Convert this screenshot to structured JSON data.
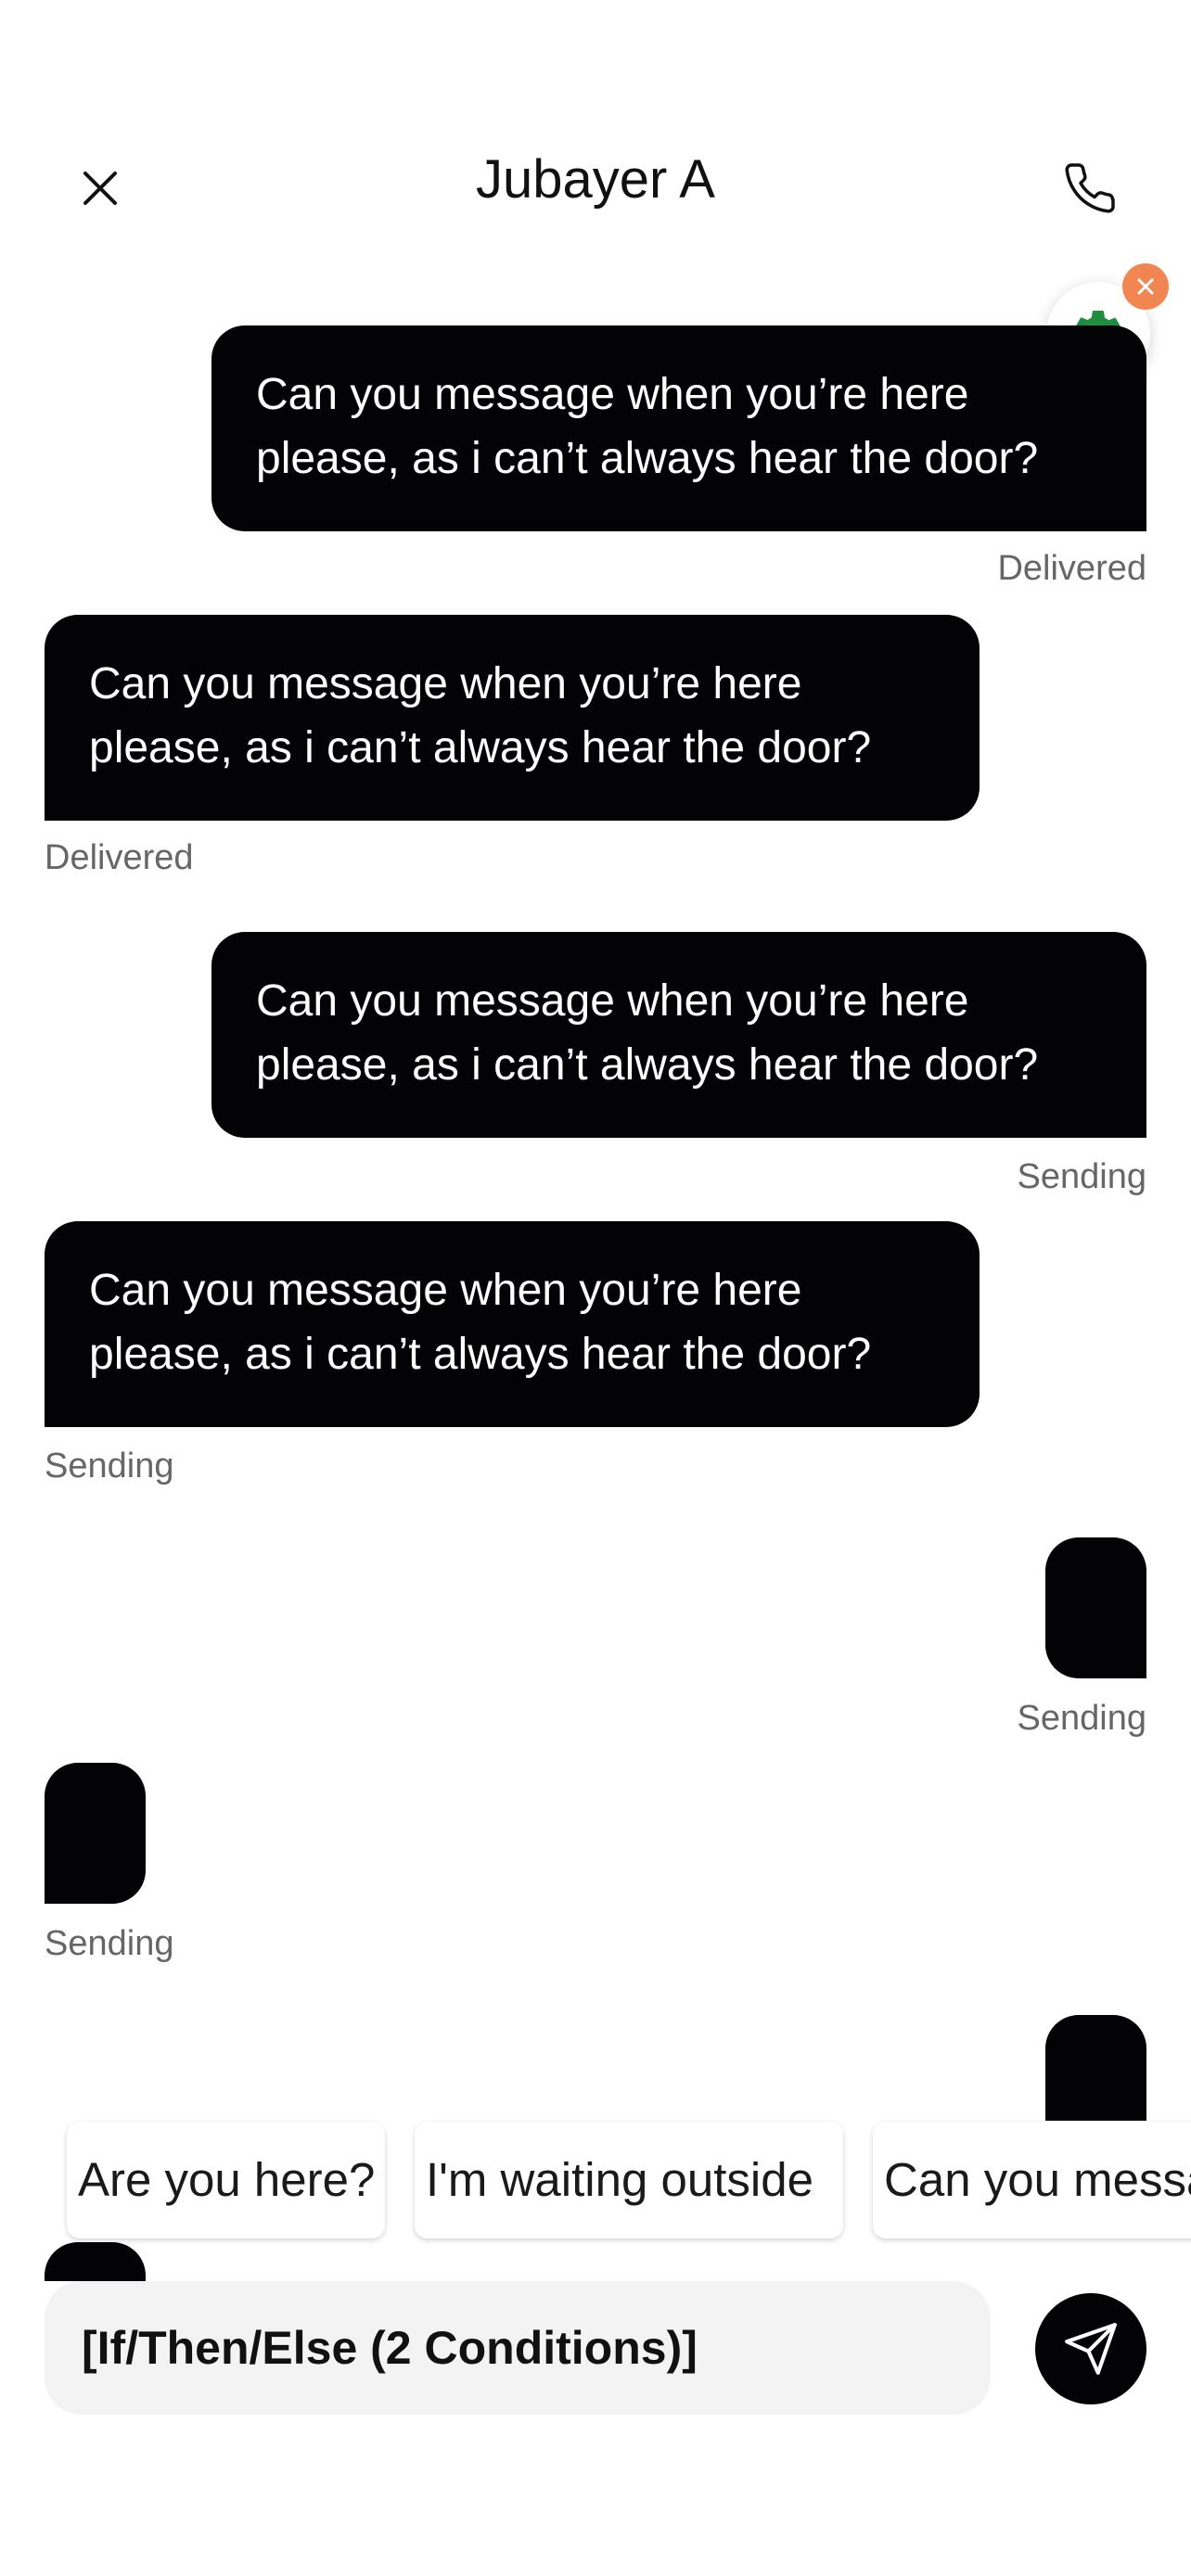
{
  "header": {
    "title": "Jubayer A",
    "close_icon": "close-icon",
    "call_icon": "phone-icon"
  },
  "fab": {
    "icon": "gear-icon",
    "dismiss_icon": "close-icon",
    "accent": "#1f8f3f",
    "dismiss_color": "#f28653"
  },
  "messages": [
    {
      "direction": "outgoing",
      "text": "Can you message when you’re here please, as i can’t always hear the door?",
      "status": "Delivered"
    },
    {
      "direction": "incoming",
      "text": "Can you message when you’re here please, as i can’t always hear the door?",
      "status": "Delivered"
    },
    {
      "direction": "outgoing",
      "text": "Can you message when you’re here please, as i can’t always hear the door?",
      "status": "Sending"
    },
    {
      "direction": "incoming",
      "text": "Can you message when you’re here please, as i can’t always hear the door?",
      "status": "Sending"
    },
    {
      "direction": "outgoing",
      "text": "",
      "status": "Sending"
    },
    {
      "direction": "incoming",
      "text": "",
      "status": "Sending"
    },
    {
      "direction": "outgoing",
      "text": "",
      "status": ""
    },
    {
      "direction": "incoming",
      "text": "",
      "status": ""
    }
  ],
  "quick_replies": [
    "Are you here?",
    "I'm waiting outside",
    "Can you messa"
  ],
  "composer": {
    "value": "[If/Then/Else (2 Conditions)]",
    "send_icon": "send-icon"
  },
  "colors": {
    "bubble": "#030305",
    "status_text": "#666666",
    "input_bg": "#f3f3f3"
  }
}
